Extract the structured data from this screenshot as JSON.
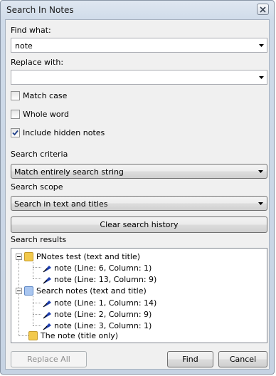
{
  "window": {
    "title": "Search In Notes"
  },
  "find": {
    "label": "Find what:",
    "value": "note"
  },
  "replace": {
    "label": "Replace with:",
    "value": ""
  },
  "options": [
    {
      "label": "Match case",
      "checked": false
    },
    {
      "label": "Whole word",
      "checked": false
    },
    {
      "label": "Include hidden notes",
      "checked": true
    }
  ],
  "criteria": {
    "label": "Search criteria",
    "value": "Match entirely search string"
  },
  "scope": {
    "label": "Search scope",
    "value": "Search in text and titles"
  },
  "clear_history_label": "Clear search history",
  "results": {
    "label": "Search results",
    "groups": [
      {
        "label": "PNotes test (text and title)",
        "folder_color": "#f2c94c",
        "items": [
          "note (Line: 6, Column: 1)",
          "note (Line: 13, Column: 9)"
        ]
      },
      {
        "label": "Search notes (text and title)",
        "folder_color": "#8fb3e8",
        "items": [
          "note (Line: 1, Column: 14)",
          "note (Line: 2, Column: 9)",
          "note (Line: 3, Column: 1)"
        ]
      },
      {
        "label": "The note (title only)",
        "folder_color": "#f2c94c",
        "items": []
      }
    ]
  },
  "buttons": {
    "replace_all": "Replace All",
    "find": "Find",
    "cancel": "Cancel"
  }
}
